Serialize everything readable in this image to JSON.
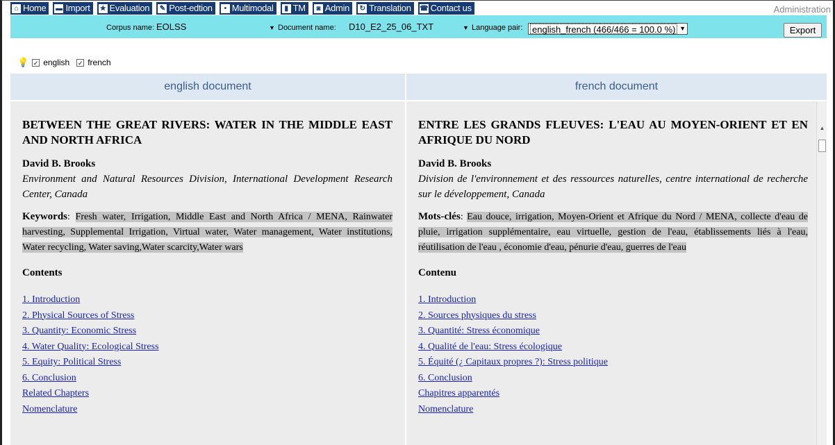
{
  "nav": {
    "items": [
      {
        "label": "Home",
        "icon": "home-icon",
        "glyph": "⌂"
      },
      {
        "label": "Import",
        "icon": "import-icon",
        "glyph": "▬"
      },
      {
        "label": "Evaluation",
        "icon": "star-icon",
        "glyph": "★"
      },
      {
        "label": "Post-edtion",
        "icon": "post-edit-icon",
        "glyph": "✎"
      },
      {
        "label": "Multimodal",
        "icon": "multimodal-icon",
        "glyph": "•"
      },
      {
        "label": "TM",
        "icon": "tm-icon",
        "glyph": "▮"
      },
      {
        "label": "Admin",
        "icon": "admin-icon",
        "glyph": "◙"
      },
      {
        "label": "Translation",
        "icon": "translation-icon",
        "glyph": "↻"
      },
      {
        "label": "Contact us",
        "icon": "contact-icon",
        "glyph": "☎"
      }
    ],
    "admin_link": "Administration"
  },
  "toolbar": {
    "corpus_label": "Corpus name:",
    "corpus_value": "EOLSS",
    "document_label": "Document name:",
    "document_value": "D10_E2_25_06_TXT",
    "language_label": "Language pair:",
    "language_value": "english_french (466/466 = 100.0 %)",
    "export_label": "Export"
  },
  "languages": {
    "english": "english",
    "french": "french"
  },
  "colors": {
    "nav_bg": "#163a73",
    "toolbar_bg": "#7fe3ec",
    "panel_head_bg": "#dde8f2",
    "panel_body_bg": "#ececec",
    "link": "#1a23b0"
  },
  "left": {
    "header": "english document",
    "title": "BETWEEN THE GREAT RIVERS: WATER IN THE MIDDLE EAST AND NORTH AFRICA",
    "author": "David B. Brooks",
    "affiliation": "Environment and Natural Resources Division, International Development Research Center, Canada",
    "keywords_label": "Keywords",
    "keywords": "Fresh water, Irrigation, Middle East and North Africa / MENA, Rainwater harvesting, Supplemental Irrigation, Virtual water, Water management, Water institutions, Water recycling, Water saving,Water scarcity,Water wars",
    "contents_label": "Contents",
    "toc": [
      "1. Introduction",
      "2. Physical Sources of Stress",
      "3. Quantity: Economic Stress",
      "4. Water Quality: Ecological Stress",
      "5. Equity: Political Stress",
      "6. Conclusion",
      "Related Chapters",
      "Nomenclature"
    ]
  },
  "right": {
    "header": "french document",
    "title": "ENTRE LES GRANDS FLEUVES: L'EAU AU MOYEN-ORIENT ET EN AFRIQUE DU NORD",
    "author": "David B. Brooks",
    "affiliation": "Division de l'environnement et des ressources naturelles, centre international de recherche sur le développement, Canada",
    "keywords_label": "Mots-clés",
    "keywords": "Eau douce, irrigation, Moyen-Orient et Afrique du Nord / MENA, collecte d'eau de pluie, irrigation supplémentaire, eau virtuelle, gestion de l'eau, établissements liés à l'eau, réutilisation de l'eau , économie d'eau, pénurie d'eau, guerres de l'eau",
    "contents_label": "Contenu",
    "toc": [
      "1. Introduction",
      "2. Sources physiques du stress",
      "3. Quantité: Stress économique",
      "4. Qualité de l'eau: Stress écologique",
      "5. Équité (¿ Capitaux propres ?): Stress politique",
      "6. Conclusion",
      "Chapitres apparentés",
      "Nomenclature"
    ]
  }
}
